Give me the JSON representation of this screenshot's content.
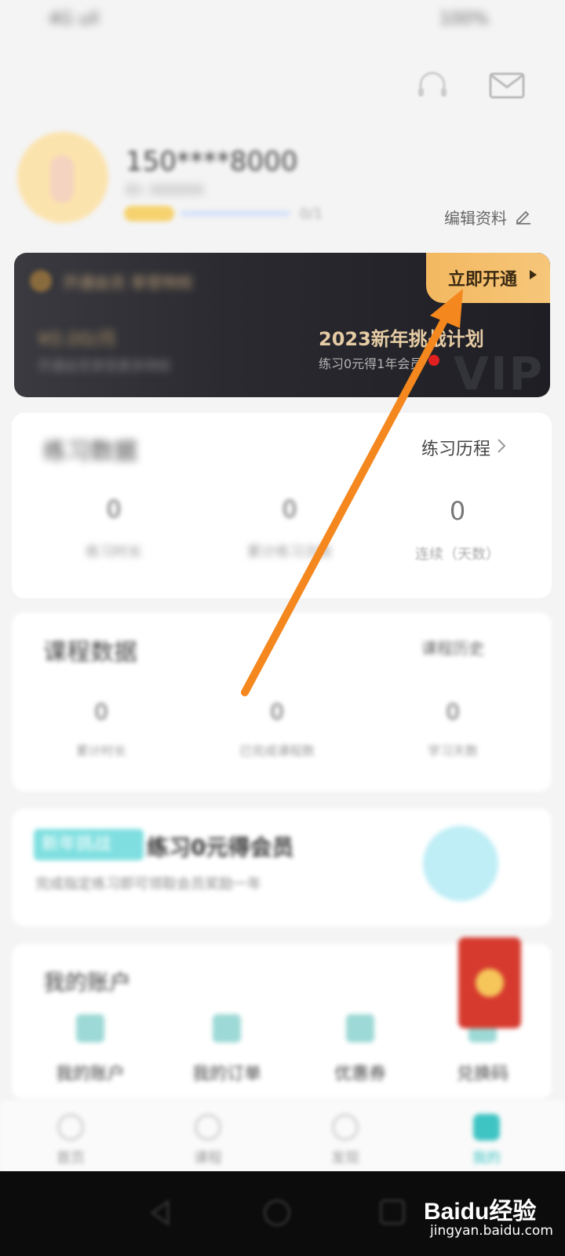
{
  "status_bar": {
    "left": "4G ull",
    "right": "100%"
  },
  "header": {
    "headset_icon": "headset-icon",
    "mail_icon": "mail-icon"
  },
  "profile": {
    "username": "150****8000",
    "sub_info": "ID: 000000",
    "progress_text": "0/1",
    "edit_label": "编辑资料"
  },
  "vip": {
    "header_text": "开通会员 享受特权",
    "open_label": "立即开通",
    "price_text": "¥0.00/月",
    "benefit_text": "开通会员享受更多特权",
    "promo_title": "2023新年挑战计划",
    "promo_sub": "练习0元得1年会员",
    "watermark": "VIP"
  },
  "practice": {
    "title": "练习数据",
    "history_label": "练习历程",
    "stats": [
      {
        "value": "0",
        "label": "练习时长"
      },
      {
        "value": "0",
        "label": "累计练习次数"
      },
      {
        "value": "0",
        "label": "连续（天数）"
      }
    ]
  },
  "course": {
    "title": "课程数据",
    "more_label": "课程历史",
    "stats": [
      {
        "value": "0",
        "label": "累计时长"
      },
      {
        "value": "0",
        "label": "已完成课程数"
      },
      {
        "value": "0",
        "label": "学习天数"
      }
    ]
  },
  "challenge": {
    "tag": "新年挑战",
    "title": "练习0元得会员",
    "desc": "完成指定练习即可领取会员奖励一年"
  },
  "account": {
    "title": "我的账户",
    "items": [
      {
        "label": "我的账户",
        "icon": "wallet-icon"
      },
      {
        "label": "我的订单",
        "icon": "cart-icon"
      },
      {
        "label": "优惠券",
        "icon": "coupon-icon"
      },
      {
        "label": "兑换码",
        "icon": "gift-icon"
      }
    ]
  },
  "bottom_nav": [
    {
      "label": "首页",
      "icon": "home-icon"
    },
    {
      "label": "课程",
      "icon": "course-icon"
    },
    {
      "label": "发现",
      "icon": "discover-icon"
    },
    {
      "label": "我的",
      "icon": "profile-icon"
    }
  ],
  "watermark": {
    "brand": "Baidu经验",
    "url": "jingyan.baidu.com"
  },
  "colors": {
    "accent_orange": "#f4871e",
    "vip_gold": "#f3b860",
    "teal": "#3fc4c4"
  }
}
